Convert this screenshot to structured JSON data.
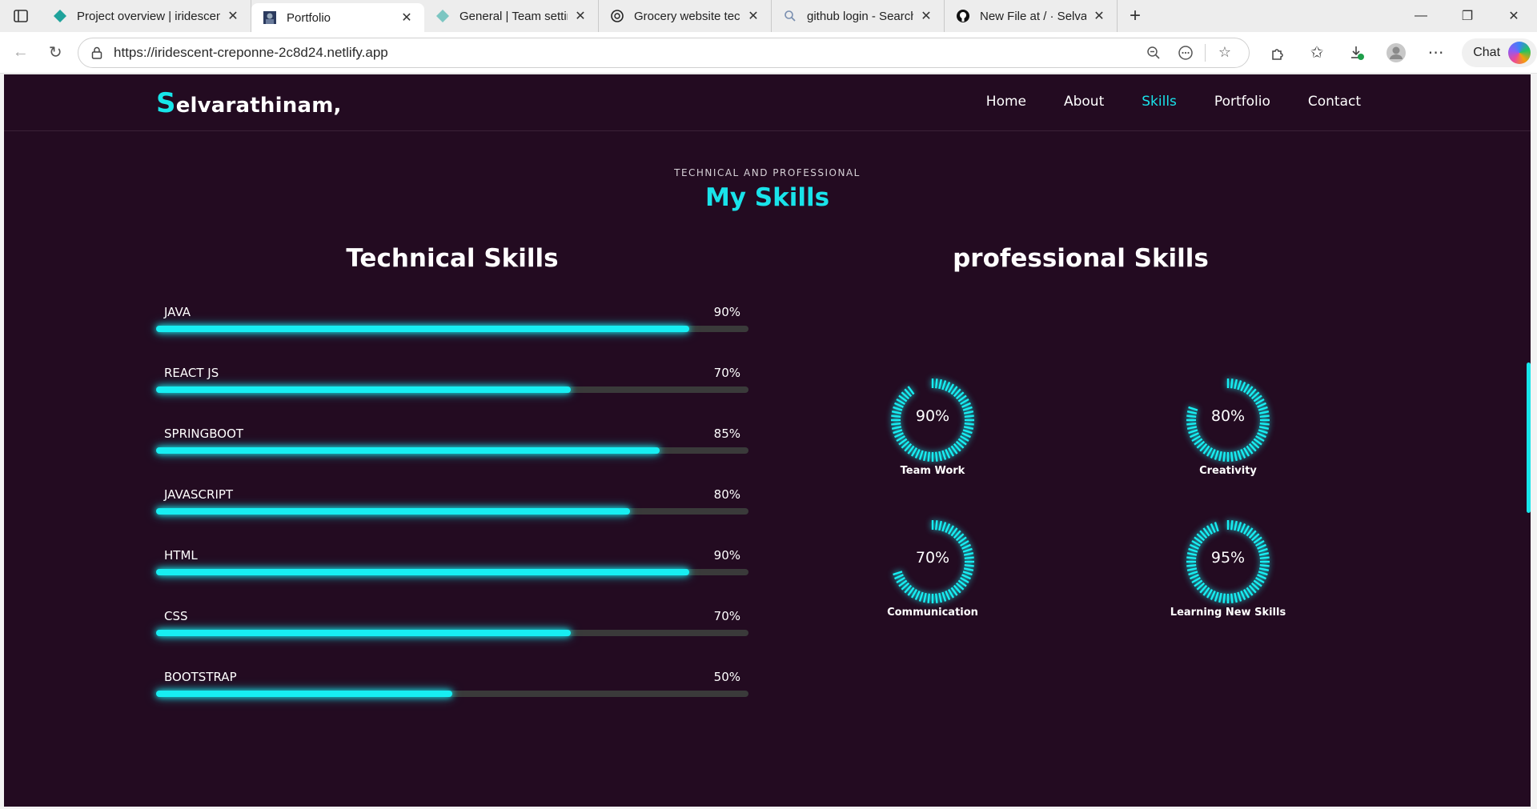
{
  "browser": {
    "tabs": [
      {
        "title": "Project overview | iridescent-",
        "icon": "netlify-diamond-icon",
        "active": false
      },
      {
        "title": "Portfolio",
        "icon": "portfolio-favicon",
        "active": true
      },
      {
        "title": "General | Team settings | selv",
        "icon": "netlify-diamond-icon",
        "active": false
      },
      {
        "title": "Grocery website tech stack",
        "icon": "chatgpt-icon",
        "active": false
      },
      {
        "title": "github login - Search",
        "icon": "search-icon",
        "active": false
      },
      {
        "title": "New File at / · Selvarathinam",
        "icon": "github-icon",
        "active": false
      }
    ],
    "url": "https://iridescent-creponne-2c8d24.netlify.app",
    "chat_label": "Chat"
  },
  "site": {
    "logo_initial": "S",
    "logo_rest": "elvarathinam,",
    "nav": [
      {
        "label": "Home",
        "active": false
      },
      {
        "label": "About",
        "active": false
      },
      {
        "label": "Skills",
        "active": true
      },
      {
        "label": "Portfolio",
        "active": false
      },
      {
        "label": "Contact",
        "active": false
      }
    ],
    "eyebrow": "TECHNICAL AND PROFESSIONAL",
    "section_title": "My Skills",
    "technical_title": "Technical Skills",
    "professional_title": "professional Skills"
  },
  "technical_skills": [
    {
      "name": "JAVA",
      "percent_label": "90%",
      "percent": 90
    },
    {
      "name": "REACT JS",
      "percent_label": "70%",
      "percent": 70
    },
    {
      "name": "SPRINGBOOT",
      "percent_label": "85%",
      "percent": 85
    },
    {
      "name": "JAVASCRIPT",
      "percent_label": "80%",
      "percent": 80
    },
    {
      "name": "HTML",
      "percent_label": "90%",
      "percent": 90
    },
    {
      "name": "CSS",
      "percent_label": "70%",
      "percent": 70
    },
    {
      "name": "BOOTSTRAP",
      "percent_label": "50%",
      "percent": 50
    }
  ],
  "professional_skills": [
    {
      "name": "Team Work",
      "percent_label": "90%",
      "percent": 90
    },
    {
      "name": "Creativity",
      "percent_label": "80%",
      "percent": 80
    },
    {
      "name": "Communication",
      "percent_label": "70%",
      "percent": 70
    },
    {
      "name": "Learning New Skills",
      "percent_label": "95%",
      "percent": 95
    }
  ],
  "colors": {
    "background": "#230b21",
    "accent": "#17eef2",
    "track": "#3a3a3a"
  }
}
